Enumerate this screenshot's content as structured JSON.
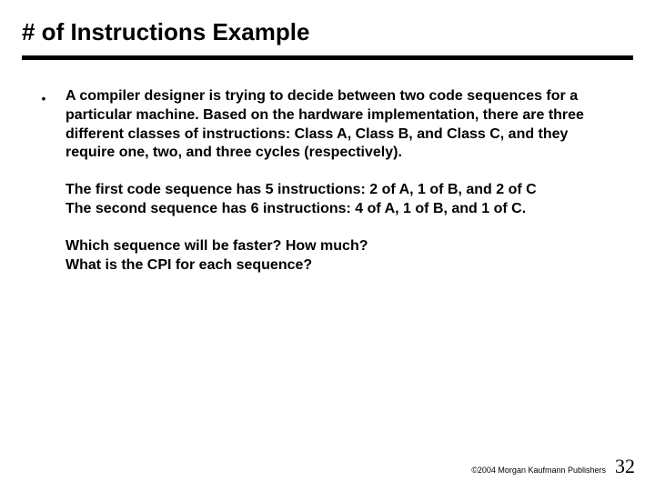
{
  "title": "# of Instructions Example",
  "bullet": "•",
  "paragraphs": {
    "p1": "A compiler designer is trying to decide between two code sequences for a particular machine.  Based on the hardware implementation, there are three different classes of instructions:  Class A, Class B, and Class C, and they require one, two, and three cycles (respectively).",
    "p2a": "The first code sequence has 5 instructions:   2 of A, 1 of B, and 2 of C",
    "p2b": "The second sequence has 6 instructions:  4 of A, 1 of B, and 1 of C.",
    "p3a": "Which sequence will be faster?  How much?",
    "p3b": "What is the CPI for each sequence?"
  },
  "footer": {
    "copyright": "©2004 Morgan Kaufmann Publishers",
    "page": "32"
  }
}
